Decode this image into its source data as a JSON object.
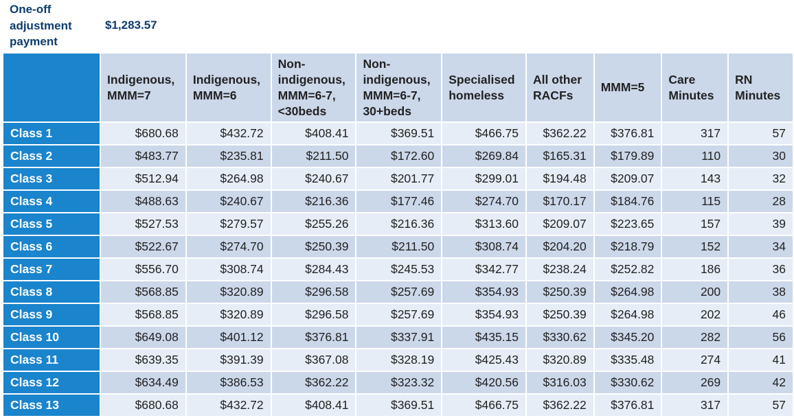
{
  "adjustment": {
    "label": "One-off adjustment payment",
    "value": "$1,283.57"
  },
  "colors": {
    "class_cell": "#1a84cc",
    "header": "#cbd8ea",
    "row_light": "#e6edf7",
    "title": "#0e3c6e"
  },
  "columns": [
    "Indigenous, MMM=7",
    "Indigenous, MMM=6",
    "Non-indigenous, MMM=6-7, <30beds",
    "Non-indigenous, MMM=6-7, 30+beds",
    "Specialised homeless",
    "All other RACFs",
    "MMM=5",
    "Care Minutes",
    "RN Minutes"
  ],
  "rows": [
    {
      "label": "Class 1",
      "values": [
        "$680.68",
        "$432.72",
        "$408.41",
        "$369.51",
        "$466.75",
        "$362.22",
        "$376.81",
        "317",
        "57"
      ]
    },
    {
      "label": "Class 2",
      "values": [
        "$483.77",
        "$235.81",
        "$211.50",
        "$172.60",
        "$269.84",
        "$165.31",
        "$179.89",
        "110",
        "30"
      ]
    },
    {
      "label": "Class 3",
      "values": [
        "$512.94",
        "$264.98",
        "$240.67",
        "$201.77",
        "$299.01",
        "$194.48",
        "$209.07",
        "143",
        "32"
      ]
    },
    {
      "label": "Class 4",
      "values": [
        "$488.63",
        "$240.67",
        "$216.36",
        "$177.46",
        "$274.70",
        "$170.17",
        "$184.76",
        "115",
        "28"
      ]
    },
    {
      "label": "Class 5",
      "values": [
        "$527.53",
        "$279.57",
        "$255.26",
        "$216.36",
        "$313.60",
        "$209.07",
        "$223.65",
        "157",
        "39"
      ]
    },
    {
      "label": "Class 6",
      "values": [
        "$522.67",
        "$274.70",
        "$250.39",
        "$211.50",
        "$308.74",
        "$204.20",
        "$218.79",
        "152",
        "34"
      ]
    },
    {
      "label": "Class 7",
      "values": [
        "$556.70",
        "$308.74",
        "$284.43",
        "$245.53",
        "$342.77",
        "$238.24",
        "$252.82",
        "186",
        "36"
      ]
    },
    {
      "label": "Class 8",
      "values": [
        "$568.85",
        "$320.89",
        "$296.58",
        "$257.69",
        "$354.93",
        "$250.39",
        "$264.98",
        "200",
        "38"
      ]
    },
    {
      "label": "Class 9",
      "values": [
        "$568.85",
        "$320.89",
        "$296.58",
        "$257.69",
        "$354.93",
        "$250.39",
        "$264.98",
        "202",
        "46"
      ]
    },
    {
      "label": "Class 10",
      "values": [
        "$649.08",
        "$401.12",
        "$376.81",
        "$337.91",
        "$435.15",
        "$330.62",
        "$345.20",
        "282",
        "56"
      ]
    },
    {
      "label": "Class 11",
      "values": [
        "$639.35",
        "$391.39",
        "$367.08",
        "$328.19",
        "$425.43",
        "$320.89",
        "$335.48",
        "274",
        "41"
      ]
    },
    {
      "label": "Class 12",
      "values": [
        "$634.49",
        "$386.53",
        "$362.22",
        "$323.32",
        "$420.56",
        "$316.03",
        "$330.62",
        "269",
        "42"
      ]
    },
    {
      "label": "Class 13",
      "values": [
        "$680.68",
        "$432.72",
        "$408.41",
        "$369.51",
        "$466.75",
        "$362.22",
        "$376.81",
        "317",
        "57"
      ]
    }
  ]
}
